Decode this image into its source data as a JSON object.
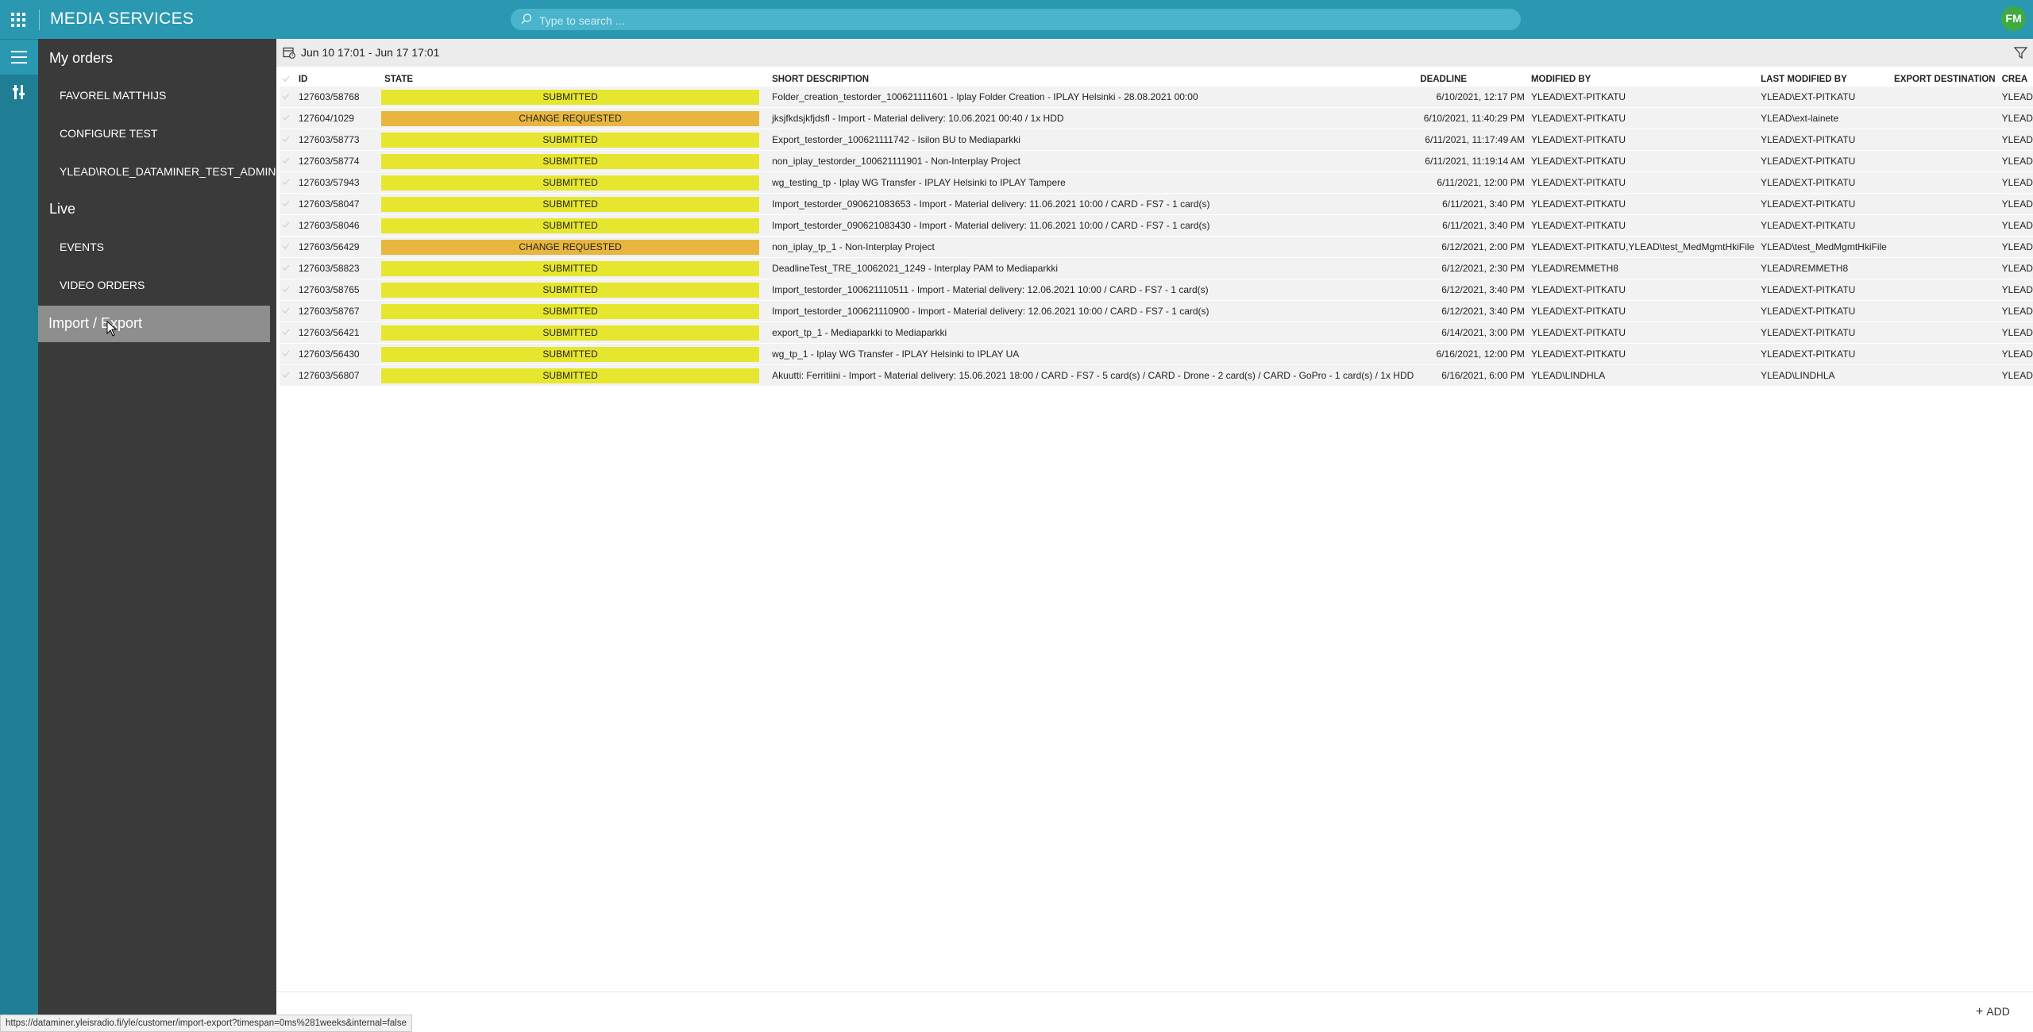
{
  "app": {
    "title": "MEDIA SERVICES",
    "user_initials": "FM"
  },
  "search": {
    "placeholder": "Type to search ..."
  },
  "sidebar": {
    "my_orders_heading": "My orders",
    "my_orders_items": [
      "FAVOREL MATTHIJS",
      "CONFIGURE TEST",
      "YLEAD\\ROLE_DATAMINER_TEST_ADMIN"
    ],
    "live_heading": "Live",
    "live_items": [
      "EVENTS",
      "VIDEO ORDERS"
    ],
    "selected_item": "Import / Export"
  },
  "toolbar": {
    "date_range": "Jun 10 17:01 - Jun 17 17:01"
  },
  "table": {
    "columns": [
      "ID",
      "STATE",
      "SHORT DESCRIPTION",
      "DEADLINE",
      "MODIFIED BY",
      "LAST MODIFIED BY",
      "EXPORT DESTINATION",
      "CREA"
    ],
    "rows": [
      {
        "id": "127603/58768",
        "state": "SUBMITTED",
        "state_kind": "submitted",
        "description": "Folder_creation_testorder_100621111601 - Iplay Folder Creation - IPLAY Helsinki - 28.08.2021 00:00",
        "deadline": "6/10/2021, 12:17 PM",
        "modified_by": "YLEAD\\EXT-PITKATU",
        "last_modified_by": "YLEAD\\EXT-PITKATU",
        "export_destination": "",
        "created": "YLEAD"
      },
      {
        "id": "127604/1029",
        "state": "CHANGE REQUESTED",
        "state_kind": "change-requested",
        "description": "jksjfkdsjkfjdsfl - Import - Material delivery: 10.06.2021 00:40 / 1x HDD",
        "deadline": "6/10/2021, 11:40:29 PM",
        "modified_by": "YLEAD\\EXT-PITKATU",
        "last_modified_by": "YLEAD\\ext-lainete",
        "export_destination": "",
        "created": "YLEAD"
      },
      {
        "id": "127603/58773",
        "state": "SUBMITTED",
        "state_kind": "submitted",
        "description": "Export_testorder_100621111742 - Isilon BU to Mediaparkki",
        "deadline": "6/11/2021, 11:17:49 AM",
        "modified_by": "YLEAD\\EXT-PITKATU",
        "last_modified_by": "YLEAD\\EXT-PITKATU",
        "export_destination": "",
        "created": "YLEAD"
      },
      {
        "id": "127603/58774",
        "state": "SUBMITTED",
        "state_kind": "submitted",
        "description": "non_iplay_testorder_100621111901 - Non-Interplay Project",
        "deadline": "6/11/2021, 11:19:14 AM",
        "modified_by": "YLEAD\\EXT-PITKATU",
        "last_modified_by": "YLEAD\\EXT-PITKATU",
        "export_destination": "",
        "created": "YLEAD"
      },
      {
        "id": "127603/57943",
        "state": "SUBMITTED",
        "state_kind": "submitted",
        "description": "wg_testing_tp - Iplay WG Transfer - IPLAY Helsinki to IPLAY Tampere",
        "deadline": "6/11/2021, 12:00 PM",
        "modified_by": "YLEAD\\EXT-PITKATU",
        "last_modified_by": "YLEAD\\EXT-PITKATU",
        "export_destination": "",
        "created": "YLEAD"
      },
      {
        "id": "127603/58047",
        "state": "SUBMITTED",
        "state_kind": "submitted",
        "description": "Import_testorder_090621083653 - Import - Material delivery: 11.06.2021 10:00 / CARD - FS7 - 1 card(s)",
        "deadline": "6/11/2021, 3:40 PM",
        "modified_by": "YLEAD\\EXT-PITKATU",
        "last_modified_by": "YLEAD\\EXT-PITKATU",
        "export_destination": "",
        "created": "YLEAD"
      },
      {
        "id": "127603/58046",
        "state": "SUBMITTED",
        "state_kind": "submitted",
        "description": "Import_testorder_090621083430 - Import - Material delivery: 11.06.2021 10:00 / CARD - FS7 - 1 card(s)",
        "deadline": "6/11/2021, 3:40 PM",
        "modified_by": "YLEAD\\EXT-PITKATU",
        "last_modified_by": "YLEAD\\EXT-PITKATU",
        "export_destination": "",
        "created": "YLEAD"
      },
      {
        "id": "127603/56429",
        "state": "CHANGE REQUESTED",
        "state_kind": "change-requested",
        "description": "non_iplay_tp_1 - Non-Interplay Project",
        "deadline": "6/12/2021, 2:00 PM",
        "modified_by": "YLEAD\\EXT-PITKATU,YLEAD\\test_MedMgmtHkiFile",
        "last_modified_by": "YLEAD\\test_MedMgmtHkiFile",
        "export_destination": "",
        "created": "YLEAD"
      },
      {
        "id": "127603/58823",
        "state": "SUBMITTED",
        "state_kind": "submitted",
        "description": "DeadlineTest_TRE_10062021_1249 - Interplay PAM to Mediaparkki",
        "deadline": "6/12/2021, 2:30 PM",
        "modified_by": "YLEAD\\REMMETH8",
        "last_modified_by": "YLEAD\\REMMETH8",
        "export_destination": "",
        "created": "YLEAD"
      },
      {
        "id": "127603/58765",
        "state": "SUBMITTED",
        "state_kind": "submitted",
        "description": "Import_testorder_100621110511 - Import - Material delivery: 12.06.2021 10:00 / CARD - FS7 - 1 card(s)",
        "deadline": "6/12/2021, 3:40 PM",
        "modified_by": "YLEAD\\EXT-PITKATU",
        "last_modified_by": "YLEAD\\EXT-PITKATU",
        "export_destination": "",
        "created": "YLEAD"
      },
      {
        "id": "127603/58767",
        "state": "SUBMITTED",
        "state_kind": "submitted",
        "description": "Import_testorder_100621110900 - Import - Material delivery: 12.06.2021 10:00 / CARD - FS7 - 1 card(s)",
        "deadline": "6/12/2021, 3:40 PM",
        "modified_by": "YLEAD\\EXT-PITKATU",
        "last_modified_by": "YLEAD\\EXT-PITKATU",
        "export_destination": "",
        "created": "YLEAD"
      },
      {
        "id": "127603/56421",
        "state": "SUBMITTED",
        "state_kind": "submitted",
        "description": "export_tp_1 - Mediaparkki to Mediaparkki",
        "deadline": "6/14/2021, 3:00 PM",
        "modified_by": "YLEAD\\EXT-PITKATU",
        "last_modified_by": "YLEAD\\EXT-PITKATU",
        "export_destination": "",
        "created": "YLEAD"
      },
      {
        "id": "127603/56430",
        "state": "SUBMITTED",
        "state_kind": "submitted",
        "description": "wg_tp_1 - Iplay WG Transfer - IPLAY Helsinki to IPLAY UA",
        "deadline": "6/16/2021, 12:00 PM",
        "modified_by": "YLEAD\\EXT-PITKATU",
        "last_modified_by": "YLEAD\\EXT-PITKATU",
        "export_destination": "",
        "created": "YLEAD"
      },
      {
        "id": "127603/56807",
        "state": "SUBMITTED",
        "state_kind": "submitted",
        "description": "Akuutti: Ferritiini - Import - Material delivery: 15.06.2021 18:00 / CARD - FS7 - 5 card(s) / CARD - Drone - 2 card(s) / CARD - GoPro - 1 card(s) / 1x HDD",
        "deadline": "6/16/2021, 6:00 PM",
        "modified_by": "YLEAD\\LINDHLA",
        "last_modified_by": "YLEAD\\LINDHLA",
        "export_destination": "",
        "created": "YLEAD"
      }
    ]
  },
  "footer": {
    "add_label": "ADD"
  },
  "status_bar": {
    "url": "https://dataminer.yleisradio.fi/yle/customer/import-export?timespan=0ms%281weeks&internal=false"
  },
  "colors": {
    "topbar": "#2a98b0",
    "rail": "#1f7e93",
    "nav": "#3a3a3a",
    "submitted": "#e6e62e",
    "change_requested": "#e8b63e"
  }
}
